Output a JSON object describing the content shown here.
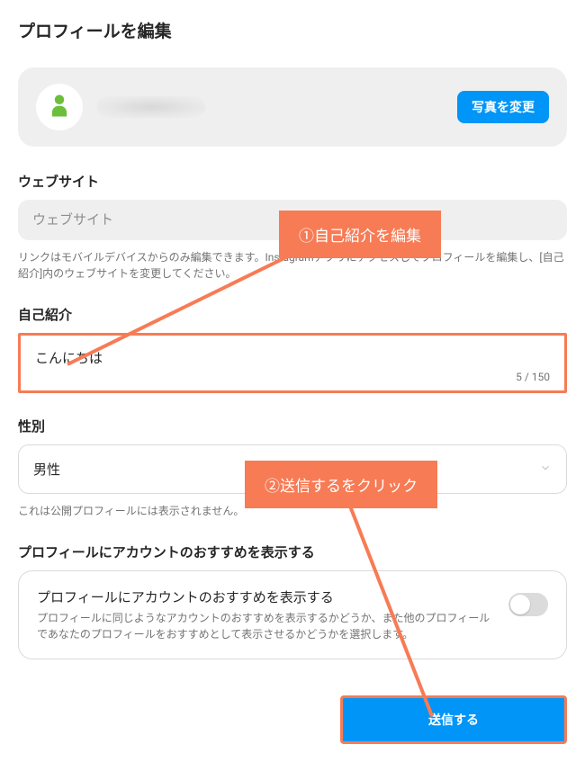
{
  "page_title": "プロフィールを編集",
  "profile_header": {
    "change_photo_label": "写真を変更"
  },
  "website": {
    "label": "ウェブサイト",
    "placeholder": "ウェブサイト",
    "help": "リンクはモバイルデバイスからのみ編集できます。Instagramアプリにアクセスしてプロフィールを編集し、[自己紹介]内のウェブサイトを変更してください。"
  },
  "bio": {
    "label": "自己紹介",
    "value": "こんにちは",
    "counter": "5 / 150"
  },
  "gender": {
    "label": "性別",
    "selected": "男性",
    "help": "これは公開プロフィールには表示されません。"
  },
  "recommend": {
    "section_label": "プロフィールにアカウントのおすすめを表示する",
    "title": "プロフィールにアカウントのおすすめを表示する",
    "desc": "プロフィールに同じようなアカウントのおすすめを表示するかどうか、また他のプロフィールであなたのプロフィールをおすすめとして表示させるかどうかを選択します。"
  },
  "submit_label": "送信する",
  "annotations": {
    "step1": "①自己紹介を編集",
    "step2": "②送信するをクリック"
  },
  "colors": {
    "accent": "#0095f6",
    "highlight": "#f77b55"
  }
}
